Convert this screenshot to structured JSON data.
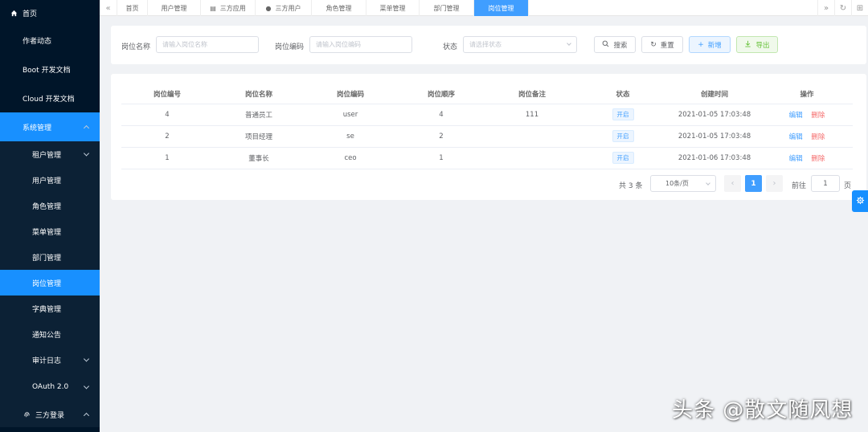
{
  "sidebar": {
    "home": "首页",
    "items": [
      {
        "label": "作者动态"
      },
      {
        "label": "Boot 开发文档"
      },
      {
        "label": "Cloud 开发文档"
      }
    ],
    "system": "系统管理",
    "submenu": [
      {
        "label": "租户管理",
        "arrow": "down"
      },
      {
        "label": "用户管理"
      },
      {
        "label": "角色管理"
      },
      {
        "label": "菜单管理"
      },
      {
        "label": "部门管理"
      },
      {
        "label": "岗位管理",
        "active": true
      },
      {
        "label": "字典管理"
      },
      {
        "label": "通知公告"
      },
      {
        "label": "审计日志",
        "arrow": "down"
      },
      {
        "label": "OAuth 2.0",
        "arrow": "down"
      }
    ],
    "social": "三方登录"
  },
  "tabs": [
    {
      "label": "首页",
      "icon": ""
    },
    {
      "label": "用户管理",
      "icon": ""
    },
    {
      "label": "三方应用",
      "icon": "app-icon"
    },
    {
      "label": "三方用户",
      "icon": "user-icon"
    },
    {
      "label": "角色管理",
      "icon": ""
    },
    {
      "label": "菜单管理",
      "icon": ""
    },
    {
      "label": "部门管理",
      "icon": ""
    },
    {
      "label": "岗位管理",
      "icon": "",
      "active": true
    }
  ],
  "search": {
    "name_label": "岗位名称",
    "name_placeholder": "请输入岗位名称",
    "code_label": "岗位编码",
    "code_placeholder": "请输入岗位编码",
    "status_label": "状态",
    "status_placeholder": "请选择状态",
    "search_btn": "搜索",
    "reset_btn": "重置",
    "add_btn": "新增",
    "export_btn": "导出"
  },
  "table": {
    "columns": [
      "岗位编号",
      "岗位名称",
      "岗位编码",
      "岗位顺序",
      "岗位备注",
      "状态",
      "创建时间",
      "操作"
    ],
    "rows": [
      {
        "id": "4",
        "name": "普通员工",
        "code": "user",
        "sort": "4",
        "remark": "111",
        "status": "开启",
        "created": "2021-01-05 17:03:48"
      },
      {
        "id": "2",
        "name": "项目经理",
        "code": "se",
        "sort": "2",
        "remark": "",
        "status": "开启",
        "created": "2021-01-05 17:03:48"
      },
      {
        "id": "1",
        "name": "董事长",
        "code": "ceo",
        "sort": "1",
        "remark": "",
        "status": "开启",
        "created": "2021-01-06 17:03:48"
      }
    ],
    "edit": "编辑",
    "delete": "删除"
  },
  "pager": {
    "total": "共 3 条",
    "size": "10条/页",
    "current": "1",
    "goto": "前往",
    "goto_value": "1",
    "page": "页"
  },
  "colors": {
    "sidebar_bg": "#001529",
    "active": "#1890ff",
    "primary": "#409eff",
    "danger": "#f56c6c",
    "success": "#67c23a"
  },
  "watermark": "头条 @散文随风想"
}
